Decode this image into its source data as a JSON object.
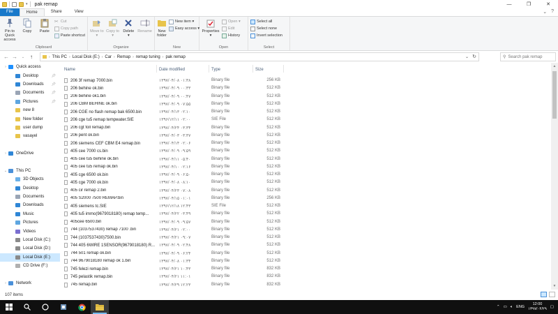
{
  "window": {
    "title": "pak remap",
    "controls": [
      "—",
      "❐",
      "✕"
    ]
  },
  "ribbon_tabs": [
    "File",
    "Home",
    "Share",
    "View"
  ],
  "ribbon_tabs_right": [
    "⌄",
    "?"
  ],
  "ribbon": {
    "clipboard": {
      "label": "Clipboard",
      "pin_label": "Pin to Quick access",
      "copy_label": "Copy",
      "paste_label": "Paste",
      "cut_label": "Cut",
      "copy_path_label": "Copy path",
      "paste_shortcut_label": "Paste shortcut"
    },
    "organize": {
      "label": "Organize",
      "move_to_label": "Move to ▾",
      "copy_to_label": "Copy to ▾",
      "delete_label": "Delete ▾",
      "rename_label": "Rename"
    },
    "new": {
      "label": "New",
      "new_folder_label": "New folder",
      "new_item_label": "New item ▾",
      "easy_access_label": "Easy access ▾"
    },
    "open": {
      "label": "Open",
      "properties_label": "Properties ▾",
      "open_label": "Open ▾",
      "edit_label": "Edit",
      "history_label": "History"
    },
    "select": {
      "label": "Select",
      "select_all_label": "Select all",
      "select_none_label": "Select none",
      "invert_label": "Invert selection"
    }
  },
  "address": {
    "breadcrumbs": [
      "This PC",
      "Local Disk (E:)",
      "Car",
      "Remap",
      "remap tuning",
      "pak remap"
    ],
    "search_placeholder": "Search pak remap"
  },
  "nav_pane": [
    {
      "label": "Quick access",
      "icon": "star-icon",
      "color": "#1e90ff",
      "indent": 0,
      "pinned": false,
      "expand": "›"
    },
    {
      "label": "Desktop",
      "icon": "desktop-icon",
      "color": "#2f86d6",
      "indent": 1,
      "pinned": true,
      "expand": ""
    },
    {
      "label": "Downloads",
      "icon": "download-icon",
      "color": "#2f86d6",
      "indent": 1,
      "pinned": true,
      "expand": ""
    },
    {
      "label": "Documents",
      "icon": "documents-icon",
      "color": "#9aa5b5",
      "indent": 1,
      "pinned": true,
      "expand": ""
    },
    {
      "label": "Pictures",
      "icon": "pictures-icon",
      "color": "#5ea6e0",
      "indent": 1,
      "pinned": true,
      "expand": ""
    },
    {
      "label": "new 8",
      "icon": "folder-icon",
      "color": "#e8c44b",
      "indent": 1,
      "pinned": false,
      "expand": ""
    },
    {
      "label": "New folder",
      "icon": "folder-icon",
      "color": "#e8c44b",
      "indent": 1,
      "pinned": false,
      "expand": ""
    },
    {
      "label": "user dump",
      "icon": "folder-icon",
      "color": "#e8c44b",
      "indent": 1,
      "pinned": false,
      "expand": ""
    },
    {
      "label": "vasayel",
      "icon": "folder-icon",
      "color": "#e8c44b",
      "indent": 1,
      "pinned": false,
      "expand": ""
    },
    {
      "label": "",
      "icon": "",
      "color": "",
      "indent": 0,
      "pinned": false,
      "expand": ""
    },
    {
      "label": "OneDrive",
      "icon": "cloud-icon",
      "color": "#2f86d6",
      "indent": 0,
      "pinned": false,
      "expand": "›"
    },
    {
      "label": "",
      "icon": "",
      "color": "",
      "indent": 0,
      "pinned": false,
      "expand": ""
    },
    {
      "label": "This PC",
      "icon": "computer-icon",
      "color": "#4a90d9",
      "indent": 0,
      "pinned": false,
      "expand": "⌄"
    },
    {
      "label": "3D Objects",
      "icon": "cube-icon",
      "color": "#6ab0e8",
      "indent": 1,
      "pinned": false,
      "expand": ""
    },
    {
      "label": "Desktop",
      "icon": "desktop-icon",
      "color": "#2f86d6",
      "indent": 1,
      "pinned": false,
      "expand": ""
    },
    {
      "label": "Documents",
      "icon": "documents-icon",
      "color": "#9aa5b5",
      "indent": 1,
      "pinned": false,
      "expand": ""
    },
    {
      "label": "Downloads",
      "icon": "download-icon",
      "color": "#2f86d6",
      "indent": 1,
      "pinned": false,
      "expand": ""
    },
    {
      "label": "Music",
      "icon": "music-icon",
      "color": "#2f86d6",
      "indent": 1,
      "pinned": false,
      "expand": ""
    },
    {
      "label": "Pictures",
      "icon": "pictures-icon",
      "color": "#5ea6e0",
      "indent": 1,
      "pinned": false,
      "expand": ""
    },
    {
      "label": "Videos",
      "icon": "video-icon",
      "color": "#7a6fd0",
      "indent": 1,
      "pinned": false,
      "expand": ""
    },
    {
      "label": "Local Disk (C:)",
      "icon": "drive-icon",
      "color": "#8a8a8a",
      "indent": 1,
      "pinned": false,
      "expand": ""
    },
    {
      "label": "Local Disk (D:)",
      "icon": "drive-icon",
      "color": "#8a8a8a",
      "indent": 1,
      "pinned": false,
      "expand": ""
    },
    {
      "label": "Local Disk (E:)",
      "icon": "drive-icon",
      "color": "#8a8a8a",
      "indent": 1,
      "pinned": false,
      "expand": "",
      "selected": true
    },
    {
      "label": "CD Drive (F:)",
      "icon": "cd-drive-icon",
      "color": "#b0b0b0",
      "indent": 1,
      "pinned": false,
      "expand": ""
    },
    {
      "label": "",
      "icon": "",
      "color": "",
      "indent": 0,
      "pinned": false,
      "expand": ""
    },
    {
      "label": "Network",
      "icon": "network-icon",
      "color": "#4a90d9",
      "indent": 0,
      "pinned": false,
      "expand": "›"
    }
  ],
  "columns": {
    "name": "Name",
    "date": "Date modified",
    "type": "Type",
    "size": "Size"
  },
  "files": [
    {
      "name": "206 3f remap 7000.bin",
      "date": "۱۳۹۷/۰۴/۰۸ ۰۱:۳۸",
      "type": "Binary file",
      "size": "256 KB"
    },
    {
      "name": "206 behine ok.bin",
      "date": "۱۳۹۷/۰۴/۰۹ ۰۰:۳۳",
      "type": "Binary file",
      "size": "512 KB"
    },
    {
      "name": "206 behine ok1.bin",
      "date": "۱۳۹۷/۰۴/۰۹ ۰۰:۴۷",
      "type": "Binary file",
      "size": "512 KB"
    },
    {
      "name": "206 CBM BEHINE ok.bin",
      "date": "۱۳۹۷/۰۴/۰۹ ۰۷:۵۵",
      "type": "Binary file",
      "size": "512 KB"
    },
    {
      "name": "206 CGE no flash remap bak 6500.bin",
      "date": "۱۳۹۷/۰۴/۱۳ ۰۲:۱۰",
      "type": "Binary file",
      "size": "512 KB"
    },
    {
      "name": "206 cge tu5 remap tempwater.SIE",
      "date": "۱۳۹۶/۱۲/۱۱ ۰۲:۰۰",
      "type": "SIE File",
      "size": "512 KB"
    },
    {
      "name": "206 cgt foll remap.bin",
      "date": "۱۳۹۷/۰۴/۲۴ ۰۳:۳۴",
      "type": "Binary file",
      "size": "512 KB"
    },
    {
      "name": "206 pent ok.bin",
      "date": "۱۳۹۷/۰۴/۰۳ ۰۳:۳۷",
      "type": "Binary file",
      "size": "512 KB"
    },
    {
      "name": "206 siemens CEF CBM E4 remap.bin",
      "date": "۱۳۹۷/۰۴/۱۴ ۰۲:۰۶",
      "type": "Binary file",
      "size": "512 KB"
    },
    {
      "name": "405 cee 7000 cs.bin",
      "date": "۱۳۹۷/۰۴/۰۹ ۰۹:۵۹",
      "type": "Binary file",
      "size": "512 KB"
    },
    {
      "name": "405 cee tu5 behine ok.bin",
      "date": "۱۳۹۷/۰۴/۱۱ ۰۵:۴۰",
      "type": "Binary file",
      "size": "512 KB"
    },
    {
      "name": "405 cee tu5 remap ok.bin",
      "date": "۱۳۹۷/۰۴/۱۰ ۰۲:۱۶",
      "type": "Binary file",
      "size": "512 KB"
    },
    {
      "name": "405 cge 6500 ok.bin",
      "date": "۱۳۹۷/۰۴/۰۹ ۰۶:۵۰",
      "type": "Binary file",
      "size": "512 KB"
    },
    {
      "name": "405 cge 7000 ok.bin",
      "date": "۱۳۹۷/۰۴/۰۸ ۰۸:۱۰",
      "type": "Binary file",
      "size": "512 KB"
    },
    {
      "name": "405 cir remap 2.bin",
      "date": "۱۳۹۷/۰۴/۲۳ ۰۷:۰۸",
      "type": "Binary file",
      "size": "512 KB"
    },
    {
      "name": "405 S2000 7500 REMAP.bin",
      "date": "۱۳۹۷/۰۴/۱۵ ۰۱:۰۱",
      "type": "Binary file",
      "size": "256 KB"
    },
    {
      "name": "405 siemens tc.SIE",
      "date": "۱۳۹۶/۱۲/۱۸ ۱۲:۴۳",
      "type": "SIE File",
      "size": "512 KB"
    },
    {
      "name": "405 tu5 immo(9679018180) remap temp...",
      "date": "۱۳۹۷/۰۴/۲۲ ۰۳:۴۹",
      "type": "Binary file",
      "size": "512 KB"
    },
    {
      "name": "405cee 6500.bin",
      "date": "۱۳۹۷/۰۴/۰۹ ۰۹:۵۷",
      "type": "Binary file",
      "size": "512 KB"
    },
    {
      "name": "744 (1037537430) remap 7100 .bin",
      "date": "۱۳۹۷/۰۴/۲۱ ۰۲:۰۰",
      "type": "Binary file",
      "size": "512 KB"
    },
    {
      "name": "744 (1037537430)7500.bin",
      "date": "۱۳۹۷/۰۴/۲۱ ۰۹:۰۷",
      "type": "Binary file",
      "size": "512 KB"
    },
    {
      "name": "744 405 6WIRE 1SENSOR(9679018180) R...",
      "date": "۱۳۹۷/۰۴/۰۹ ۰۲:۴۸",
      "type": "Binary file",
      "size": "512 KB"
    },
    {
      "name": "744 501 remap ok.bin",
      "date": "۱۳۹۷/۰۴/۰۹ ۰۶:۲۴",
      "type": "Binary file",
      "size": "512 KB"
    },
    {
      "name": "744 9679018180 remap ok 1.bin",
      "date": "۱۳۹۷/۰۴/۰۸ ۰۱:۳۴",
      "type": "Binary file",
      "size": "512 KB"
    },
    {
      "name": "745 felezi remap.bin",
      "date": "۱۳۹۷/۰۴/۲۱ ۱۰:۴۳",
      "type": "Binary file",
      "size": "832 KB"
    },
    {
      "name": "745 pelastik remap.bin",
      "date": "۱۳۹۷/۰۴/۲۱ ۱۱:۰۱",
      "type": "Binary file",
      "size": "832 KB"
    },
    {
      "name": "745 remap.bin",
      "date": "۱۳۹۷/۰۴/۲۹ ۱۲:۲۳",
      "type": "Binary file",
      "size": "832 KB"
    }
  ],
  "status": {
    "item_count": "107 items"
  },
  "taskbar": {
    "time": "12:00",
    "date": "۱۳۹۷/۰۴/۲۹",
    "lang": "ENG"
  },
  "colors": {
    "accent": "#1979ca",
    "selection": "#cce8ff",
    "folder": "#e8c44b"
  }
}
